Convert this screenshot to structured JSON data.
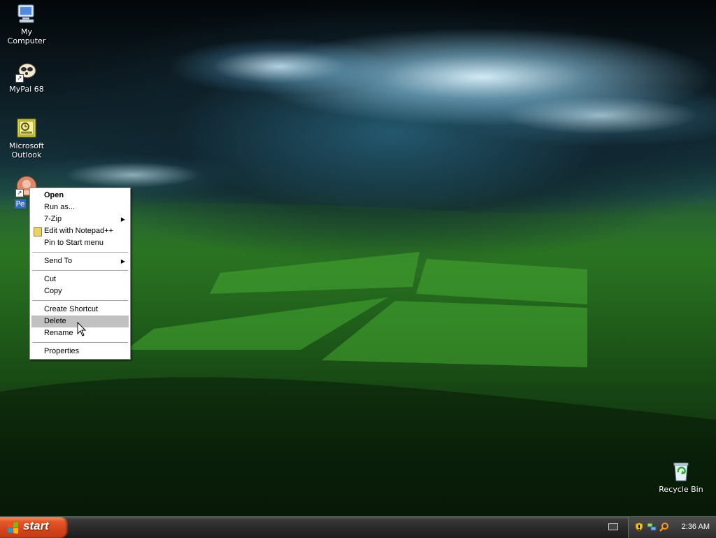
{
  "desktop": {
    "icons": [
      {
        "label": "My Computer",
        "icon": "my-computer-icon"
      },
      {
        "label": "MyPal 68",
        "icon": "mypal-icon"
      },
      {
        "label": "Microsoft Outlook",
        "icon": "outlook-icon"
      },
      {
        "label": "Pe",
        "icon": "person-icon"
      },
      {
        "label": "Recycle Bin",
        "icon": "recycle-bin-icon"
      }
    ]
  },
  "context_menu": {
    "items": [
      {
        "label": "Open"
      },
      {
        "label": "Run as..."
      },
      {
        "label": "7-Zip"
      },
      {
        "label": "Edit with Notepad++"
      },
      {
        "label": "Pin to Start menu"
      },
      {
        "label": "Send To"
      },
      {
        "label": "Cut"
      },
      {
        "label": "Copy"
      },
      {
        "label": "Create Shortcut"
      },
      {
        "label": "Delete"
      },
      {
        "label": "Rename"
      },
      {
        "label": "Properties"
      }
    ],
    "highlighted": "Delete"
  },
  "taskbar": {
    "start_label": "start",
    "clock": "2:36 AM"
  },
  "colors": {
    "start_button": "#d3451c",
    "menu_highlight": "#c1c1c1",
    "selection": "#316ac5"
  }
}
